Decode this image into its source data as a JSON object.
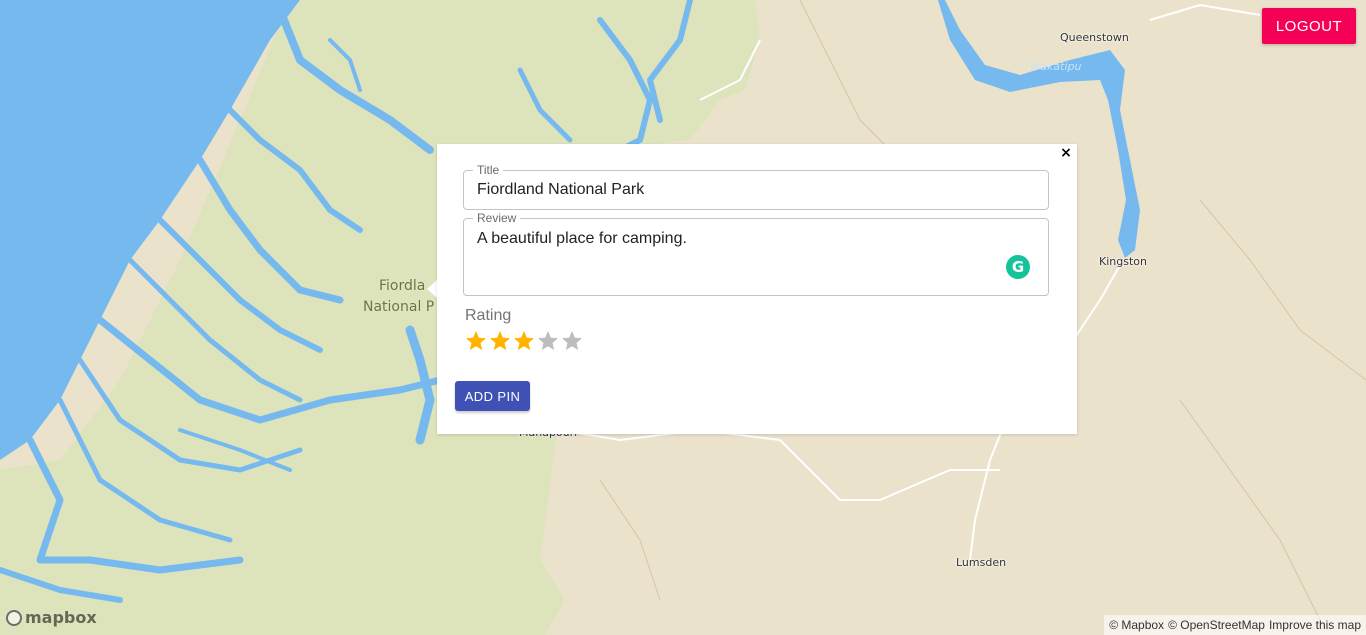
{
  "header": {
    "logout_label": "LOGOUT"
  },
  "map": {
    "places": {
      "queenstown": "Queenstown",
      "kingston": "Kingston",
      "lumsden": "Lumsden",
      "manapouri": "Manapouri",
      "wakatipu": "Wakatipu",
      "fiordland_line1": "Fiordla",
      "fiordland_line2": "National P"
    },
    "colors": {
      "water": "#74b8ee",
      "park": "#dce3ba",
      "land": "#ebe2cc"
    }
  },
  "popup": {
    "close_label": "×",
    "title_field": {
      "label": "Title",
      "value": "Fiordland National Park"
    },
    "review_field": {
      "label": "Review",
      "value": "A beautiful place for camping."
    },
    "grammarly_icon": "G",
    "rating": {
      "label": "Rating",
      "value": 3,
      "max": 5,
      "filled_color": "#ffb400",
      "empty_color": "#bdbdbd"
    },
    "submit_label": "ADD PIN"
  },
  "footer": {
    "logo_text": "mapbox",
    "attribution": [
      "© Mapbox",
      "© OpenStreetMap",
      "Improve this map"
    ]
  }
}
